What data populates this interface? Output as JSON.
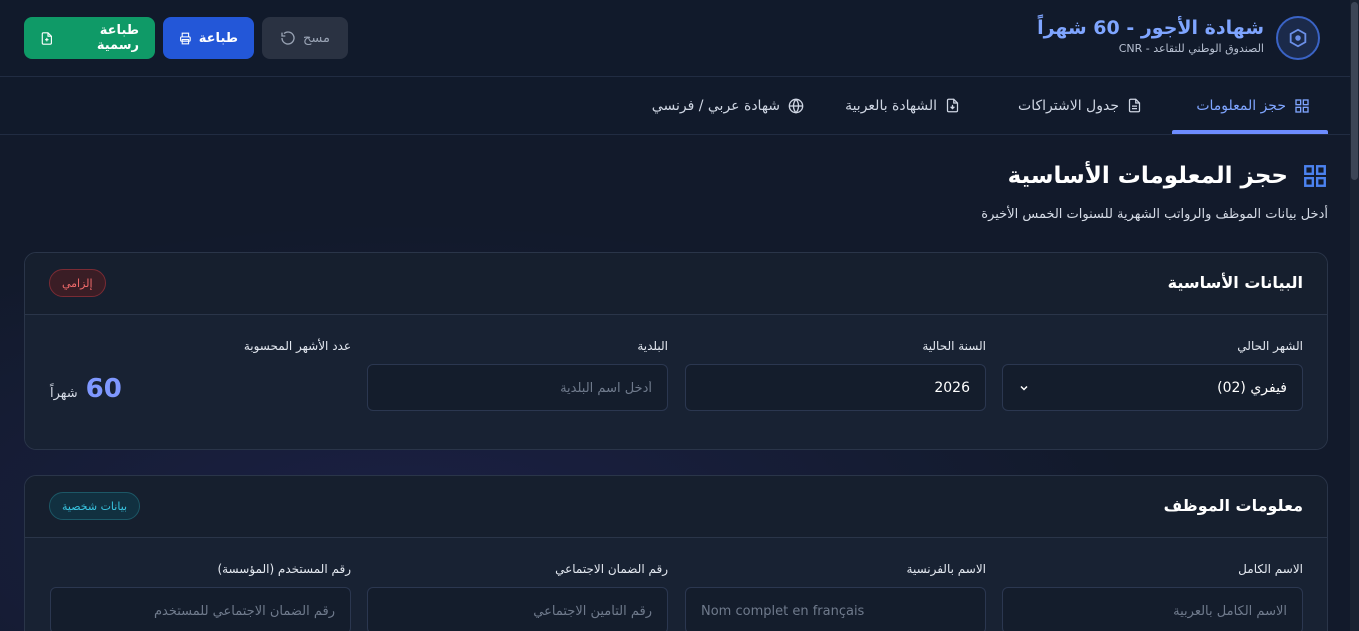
{
  "header": {
    "title": "شهادة الأجور - 60 شهراً",
    "subtitle": "الصندوق الوطني للتقاعد - CNR",
    "buttons": {
      "official_print": "طباعة رسمية",
      "print": "طباعة",
      "clear": "مسح"
    }
  },
  "tabs": [
    {
      "label": "حجز المعلومات",
      "icon": "grid-icon",
      "active": true
    },
    {
      "label": "جدول الاشتراكات",
      "icon": "document-icon",
      "active": false
    },
    {
      "label": "الشهادة بالعربية",
      "icon": "file-download-icon",
      "active": false
    },
    {
      "label": "شهادة عربي / فرنسي",
      "icon": "globe-icon",
      "active": false
    }
  ],
  "page": {
    "title": "حجز المعلومات الأساسية",
    "subtitle": "أدخل بيانات الموظف والرواتب الشهرية للسنوات الخمس الأخيرة"
  },
  "basic_card": {
    "title": "البيانات الأساسية",
    "badge": "إلزامي",
    "fields": {
      "month_label": "الشهر الحالي",
      "month_value": "فيفري (02)",
      "year_label": "السنة الحالية",
      "year_value": "2026",
      "municipality_label": "البلدية",
      "municipality_placeholder": "أدخل اسم البلدية",
      "months_count_label": "عدد الأشهر المحسوبة",
      "months_count_value": "60",
      "months_count_unit": "شهراً"
    }
  },
  "employee_card": {
    "title": "معلومات الموظف",
    "badge": "بيانات شخصية",
    "fields": {
      "fullname_label": "الاسم الكامل",
      "fullname_placeholder": "الاسم الكامل بالعربية",
      "french_name_label": "الاسم بالفرنسية",
      "french_name_placeholder": "Nom complet en français",
      "social_security_label": "رقم الضمان الاجتماعي",
      "social_security_placeholder": "رقم التأمين الاجتماعي",
      "employer_number_label": "رقم المستخدم (المؤسسة)",
      "employer_number_placeholder": "رقم الضمان الاجتماعي للمستخدم"
    }
  },
  "colors": {
    "accent": "#7fa5ff",
    "green_button": "#0f9a67",
    "blue_button": "#2357d8",
    "background": "#121a2b"
  }
}
